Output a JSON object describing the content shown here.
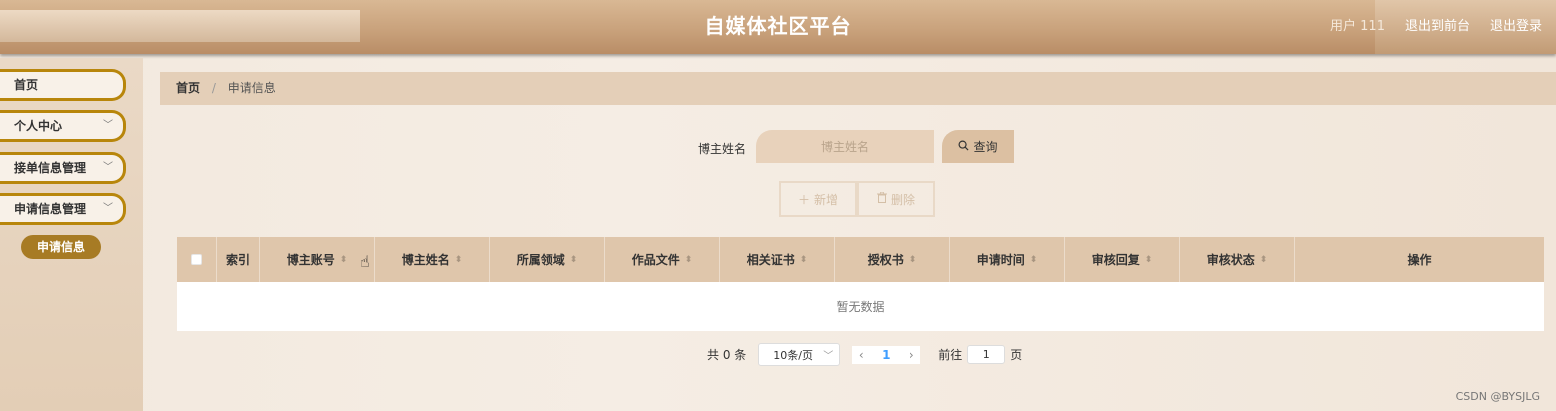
{
  "header": {
    "title": "自媒体社区平台",
    "user": "用户 111",
    "exit_front": "退出到前台",
    "logout": "退出登录"
  },
  "sidebar": {
    "items": [
      {
        "label": "首页",
        "has_submenu": false
      },
      {
        "label": "个人中心",
        "has_submenu": true
      },
      {
        "label": "接单信息管理",
        "has_submenu": true
      },
      {
        "label": "申请信息管理",
        "has_submenu": true
      }
    ],
    "active_sub": "申请信息"
  },
  "breadcrumb": {
    "home": "首页",
    "separator": "/",
    "current": "申请信息"
  },
  "search": {
    "label": "博主姓名",
    "placeholder": "博主姓名",
    "button": "查询",
    "button_icon": "search-icon"
  },
  "actions": {
    "add": "新增",
    "add_icon": "plus-icon",
    "delete": "删除",
    "delete_icon": "trash-icon"
  },
  "table": {
    "columns": [
      {
        "label": "索引",
        "sortable": false
      },
      {
        "label": "博主账号",
        "sortable": true
      },
      {
        "label": "博主姓名",
        "sortable": true
      },
      {
        "label": "所属领域",
        "sortable": true
      },
      {
        "label": "作品文件",
        "sortable": true
      },
      {
        "label": "相关证书",
        "sortable": true
      },
      {
        "label": "授权书",
        "sortable": true
      },
      {
        "label": "申请时间",
        "sortable": true
      },
      {
        "label": "审核回复",
        "sortable": true
      },
      {
        "label": "审核状态",
        "sortable": true
      },
      {
        "label": "操作",
        "sortable": false
      }
    ],
    "empty_text": "暂无数据"
  },
  "pagination": {
    "total": "共 0 条",
    "page_size": "10条/页",
    "current_page": "1",
    "goto_label": "前往",
    "goto_value": "1",
    "page_unit": "页"
  },
  "watermark": "CSDN @BYSJLG",
  "colors": {
    "accent": "#a77b24",
    "header": "#c9a27c",
    "table_header": "#dfc6ab"
  }
}
